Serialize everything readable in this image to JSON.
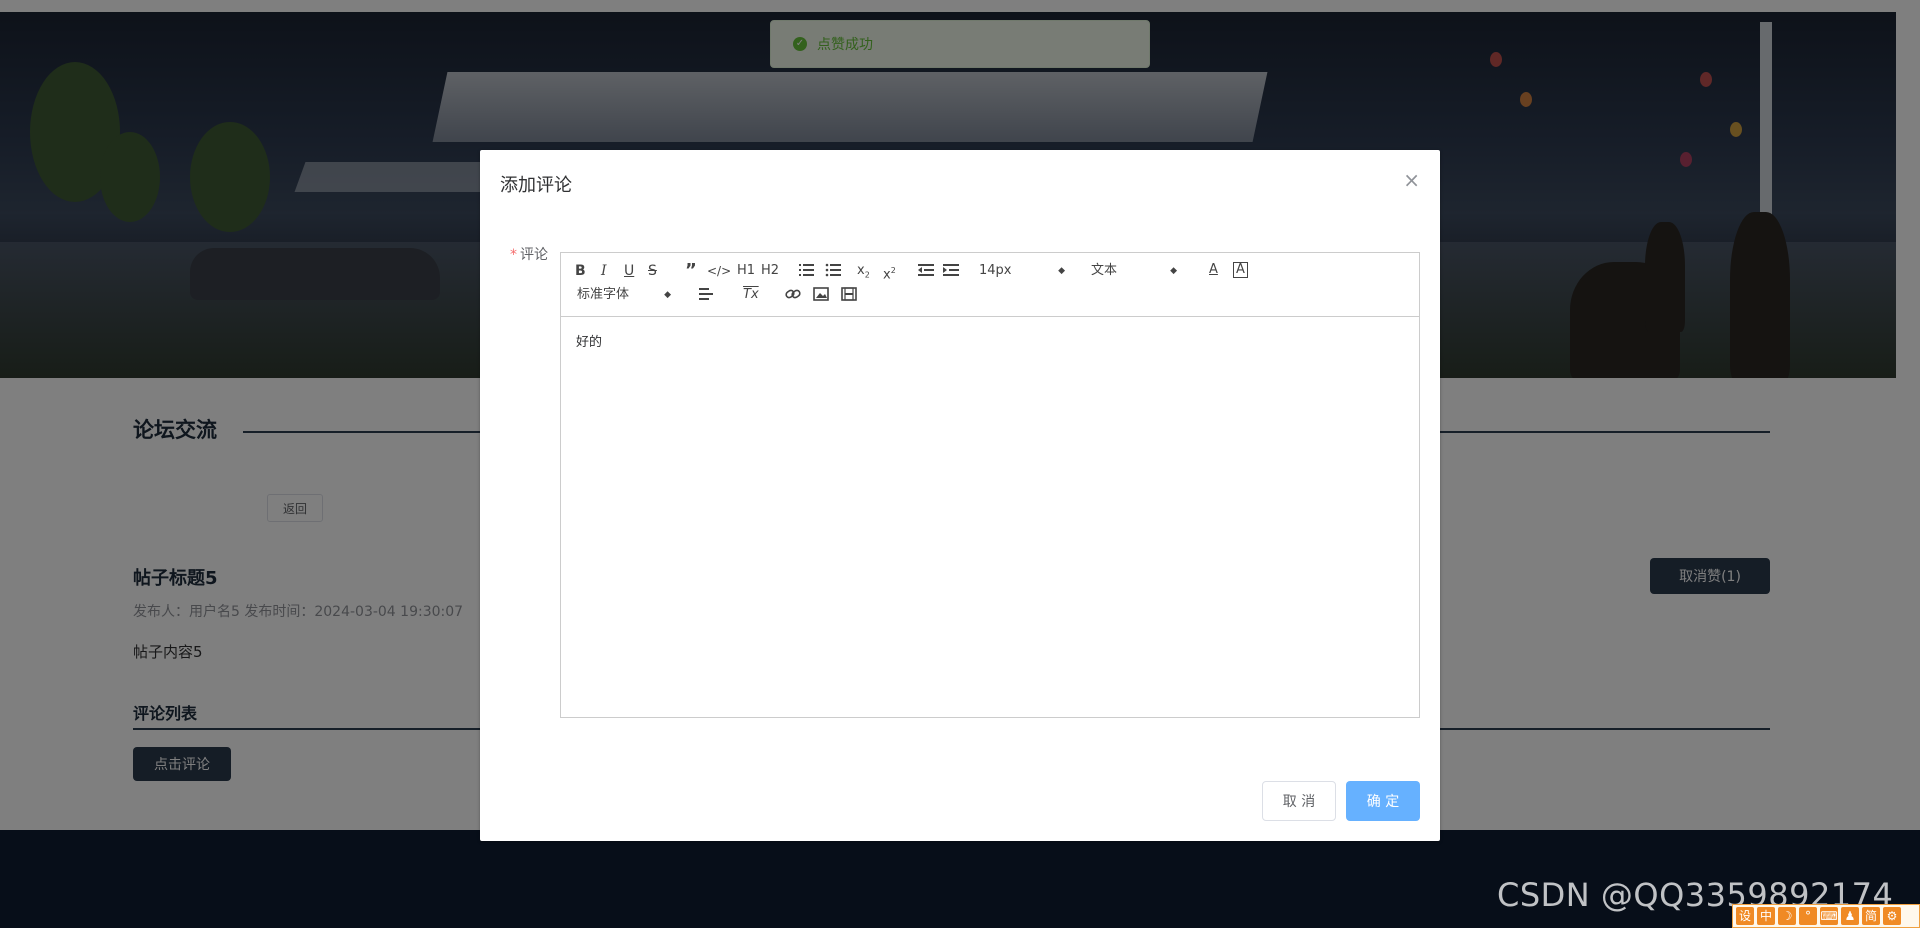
{
  "toast": {
    "message": "点赞成功",
    "icon": "check-circle-icon"
  },
  "forum": {
    "section_title": "论坛交流",
    "back_label": "返回",
    "post_title": "帖子标题5",
    "post_meta": "发布人：用户名5   发布时间：2024-03-04 19:30:07",
    "post_content": "帖子内容5",
    "unlike_label": "取消赞(1)",
    "comments_title": "评论列表",
    "comment_btn_label": "点击评论"
  },
  "dialog": {
    "title": "添加评论",
    "field_label": "评论",
    "editor_content": "好的",
    "cancel_label": "取 消",
    "confirm_label": "确 定",
    "toolbar": {
      "h1": "H1",
      "h2": "H2",
      "font_size": "14px",
      "header_select": "文本",
      "font_family": "标准字体"
    }
  },
  "watermark": "CSDN @QQ3359892174",
  "ime_bar": [
    "设",
    "中",
    "☽",
    "°",
    "⌨",
    "♟",
    "简",
    "⚙"
  ]
}
